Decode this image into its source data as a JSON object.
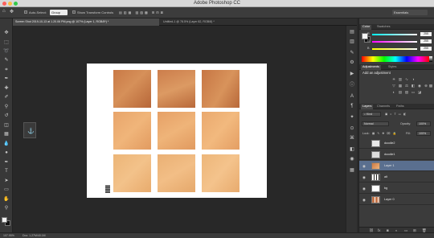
{
  "app": {
    "title": "Adobe Photoshop CC"
  },
  "options_bar": {
    "auto_select_label": "Auto-Select:",
    "auto_select_value": "Group",
    "show_transform_label": "Show Transform Controls",
    "workspace": "Essentials"
  },
  "tabs": [
    {
      "label": "Screen Shot 2019-10-13 at 1.20.06 PM.png @ 107% (Layer 1, RGB/8*) *",
      "active": true
    },
    {
      "label": "Untitled-1 @ 78.5% (Layer 82, RGB/8) *",
      "active": false
    }
  ],
  "status": {
    "zoom": "107.95%",
    "doc": "Doc: 1.27M/40.1M"
  },
  "color_panel": {
    "tabs": [
      "Color",
      "Swatches"
    ],
    "channels": [
      {
        "label": "R",
        "value": "255",
        "color": "#ff4a4a"
      },
      {
        "label": "G",
        "value": "255",
        "color": "#4ad64a"
      },
      {
        "label": "B",
        "value": "255",
        "color": "#4a6cff"
      }
    ]
  },
  "adjustments_panel": {
    "tabs": [
      "Adjustments",
      "Styles"
    ],
    "title": "Add an adjustment",
    "icons": [
      "brightness-icon",
      "levels-icon",
      "curves-icon",
      "exposure-icon",
      "vibrance-icon",
      "hue-icon",
      "balance-icon",
      "bw-icon",
      "photofilter-icon",
      "mixer-icon",
      "lookup-icon",
      "invert-icon",
      "posterize-icon",
      "threshold-icon",
      "gradientmap-icon",
      "selectivecolor-icon"
    ]
  },
  "layers_panel": {
    "tabs": [
      "Layers",
      "Channels",
      "Paths"
    ],
    "filter_label": "Kind",
    "blend_mode": "Normal",
    "opacity_label": "Opacity:",
    "opacity_value": "100%",
    "lock_label": "Lock:",
    "fill_label": "Fill:",
    "fill_value": "100%",
    "layers": [
      {
        "name": "doodle2",
        "visible": false,
        "selected": false,
        "thumb": "#e8e8e8"
      },
      {
        "name": "doodle1",
        "visible": false,
        "selected": false,
        "thumb": "#dcdcdc"
      },
      {
        "name": "Layer 1",
        "visible": true,
        "selected": true,
        "thumb": "#e39a5f"
      },
      {
        "name": "alt",
        "visible": true,
        "selected": false,
        "thumb": "#f0f0f0"
      },
      {
        "name": "bg",
        "visible": true,
        "selected": false,
        "thumb": "#ffffff"
      },
      {
        "name": "Layer 0",
        "visible": true,
        "selected": false,
        "thumb": "#c47448"
      }
    ]
  }
}
